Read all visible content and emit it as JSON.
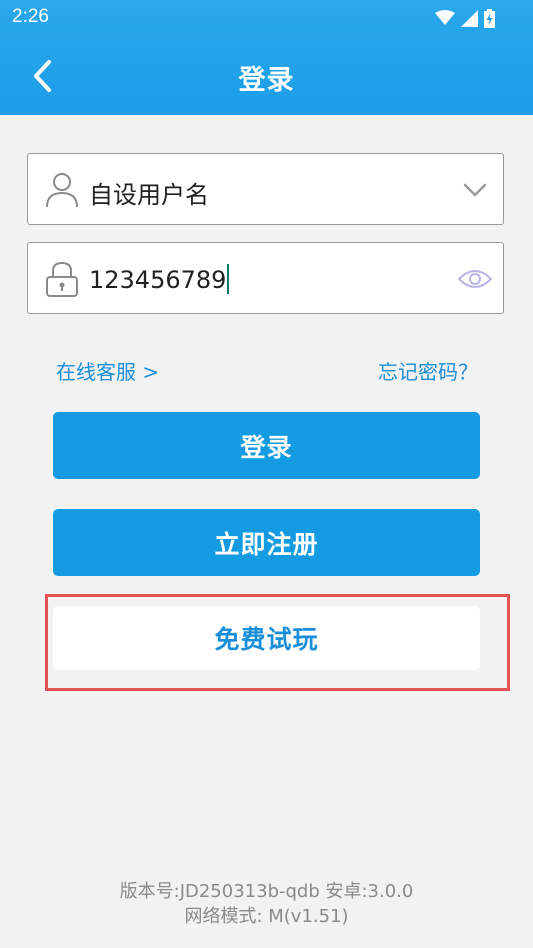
{
  "status_bar": {
    "time": "2:26",
    "icons": [
      "wifi-icon",
      "signal-icon",
      "battery-charging-icon"
    ]
  },
  "header": {
    "title": "登录",
    "back_icon": "chevron-left-icon",
    "background_color": "#1b9de6"
  },
  "username_field": {
    "icon": "user-icon",
    "value": "自设用户名",
    "dropdown_icon": "chevron-down-icon"
  },
  "password_field": {
    "icon": "lock-icon",
    "value": "123456789",
    "toggle_icon": "eye-icon"
  },
  "links": {
    "online_service": "在线客服 >",
    "forgot_password": "忘记密码？"
  },
  "buttons": {
    "login": "登录",
    "register": "立即注册",
    "free_trial": "免费试玩"
  },
  "colors": {
    "primary": "#159be2",
    "link": "#1a8ed9",
    "highlight_border": "#e45252"
  },
  "footer": {
    "version_line": "版本号:JD250313b-qdb  安卓:3.0.0",
    "network_line": "网络模式: M(v1.51)"
  }
}
